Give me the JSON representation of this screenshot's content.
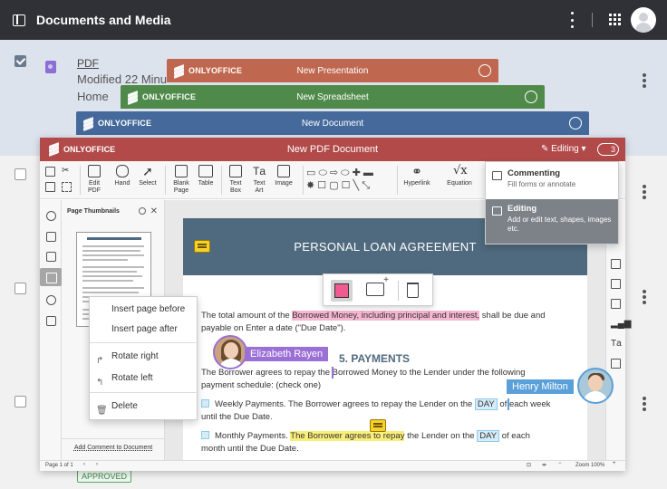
{
  "app": {
    "title": "Documents and Media"
  },
  "file": {
    "name": "PDF",
    "modified": "Modified 22 Minu",
    "location": "Home",
    "status": "APPROVED"
  },
  "stack": [
    {
      "brand": "ONLYOFFICE",
      "title": "New Presentation",
      "color": "#c0674f"
    },
    {
      "brand": "ONLYOFFICE",
      "title": "New Spreadsheet",
      "color": "#4f8a4a"
    },
    {
      "brand": "ONLYOFFICE",
      "title": "New Document",
      "color": "#44699a"
    }
  ],
  "editor": {
    "brand": "ONLYOFFICE",
    "title": "New PDF Document",
    "mode": "Editing",
    "users_count": "3",
    "header_color": "#b24a4a",
    "toolbar": {
      "edit_pdf": "Edit\nPDF",
      "hand": "Hand",
      "select": "Select",
      "blank_page": "Blank\nPage",
      "table": "Table",
      "text_box": "Text\nBox",
      "text_art": "Text\nArt",
      "image": "Image",
      "hyperlink": "Hyperlink",
      "equation": "Equation"
    },
    "thumbnails": {
      "header": "Page Thumbnails",
      "add_comment": "Add Comment to Document"
    },
    "status": {
      "page": "Page 1 of 1",
      "zoom": "Zoom 100%"
    }
  },
  "document": {
    "heading": "PERSONAL LOAN AGREEMENT",
    "p1_before": "The total amount of the ",
    "p1_hl": "Borrowed Money, including principal and interest,",
    "p1_after": " shall be due and",
    "p1_line2": "payable on Enter a date (\"Due Date\").",
    "section": "5. PAYMENTS",
    "p2_line1": "The Borrower agrees to repay the Borrowed Money to the Lender under the following",
    "p2_line2": "payment schedule: (check one)",
    "weekly_before": "Weekly Payments. The Borrower agrees to repay the Lender on the ",
    "weekly_field": "DAY",
    "weekly_after": " of each week",
    "weekly_line2": "until the Due Date.",
    "monthly_before": "Monthly Payments. ",
    "monthly_hl": "The Borrower agrees to repay",
    "monthly_mid": " the Lender on the ",
    "monthly_field": "DAY",
    "monthly_after": " of each",
    "monthly_line2": "month until the Due Date."
  },
  "context_menu": {
    "insert_before": "Insert page before",
    "insert_after": "Insert page after",
    "rotate_right": "Rotate right",
    "rotate_left": "Rotate left",
    "delete": "Delete"
  },
  "modes_menu": [
    {
      "title": "Commenting",
      "desc": "Fill forms or annotate"
    },
    {
      "title": "Editing",
      "desc": "Add or edit text, shapes, images etc."
    }
  ],
  "collaborators": [
    {
      "name": "Elizabeth Rayen",
      "color": "#9a6fd6"
    },
    {
      "name": "Henry Milton",
      "color": "#5ba0d9"
    }
  ]
}
